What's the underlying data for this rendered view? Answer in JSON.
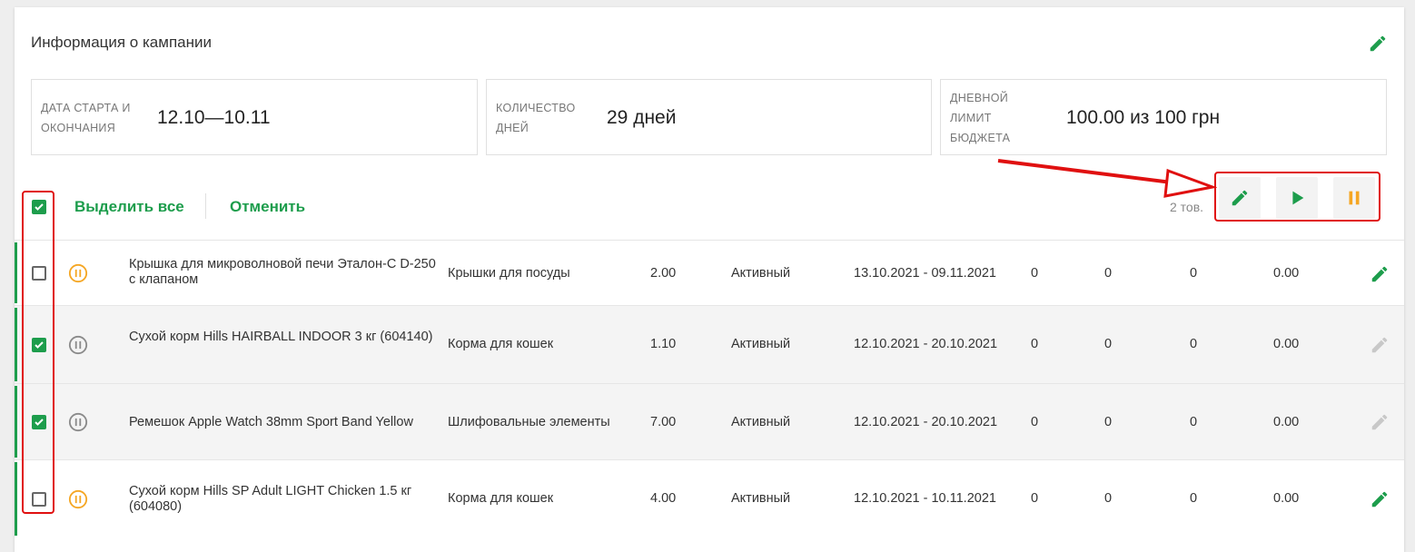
{
  "panel": {
    "title": "Информация о кампании"
  },
  "info": {
    "dates": {
      "label_1": "ДАТА СТАРТА И",
      "label_2": "ОКОНЧАНИЯ",
      "value": "12.10—10.11"
    },
    "days": {
      "label_1": "КОЛИЧЕСТВО",
      "label_2": "ДНЕЙ",
      "value": "29 дней"
    },
    "budget": {
      "label_1": "ДНЕВНОЙ",
      "label_2": "ЛИМИТ",
      "label_3": "БЮДЖЕТА",
      "value": "100.00 из 100 грн"
    }
  },
  "toolbar": {
    "select_all": "Выделить все",
    "cancel": "Отменить",
    "count": "2 тов."
  },
  "colors": {
    "accent": "#1d9d4c",
    "pause": "#f5a623",
    "inactive": "#8a8a8a",
    "highlight": "#e01010"
  },
  "rows": [
    {
      "checked": false,
      "status_icon": "pause-circle-icon",
      "name": "Крышка для микроволновой печи Эталон-С D-250 с клапаном",
      "category": "Крышки для посуды",
      "bid": "2.00",
      "status": "Активный",
      "period": "13.10.2021 - 09.11.2021",
      "c1": "0",
      "c2": "0",
      "c3": "0",
      "cost": "0.00",
      "editable": true
    },
    {
      "checked": true,
      "status_icon": "pause-circle-icon",
      "name": "Сухой корм Hills HAIRBALL INDOOR 3 кг (604140)",
      "category": "Корма для кошек",
      "bid": "1.10",
      "status": "Активный",
      "period": "12.10.2021 - 20.10.2021",
      "c1": "0",
      "c2": "0",
      "c3": "0",
      "cost": "0.00",
      "editable": false
    },
    {
      "checked": true,
      "status_icon": "pause-circle-icon",
      "name": "Ремешок Apple Watch 38mm Sport Band Yellow",
      "category": "Шлифовальные элементы",
      "bid": "7.00",
      "status": "Активный",
      "period": "12.10.2021 - 20.10.2021",
      "c1": "0",
      "c2": "0",
      "c3": "0",
      "cost": "0.00",
      "editable": false
    },
    {
      "checked": false,
      "status_icon": "pause-circle-icon",
      "name": "Сухой корм Hills SP Adult LIGHT Chicken 1.5 кг (604080)",
      "category": "Корма для кошек",
      "bid": "4.00",
      "status": "Активный",
      "period": "12.10.2021 - 10.11.2021",
      "c1": "0",
      "c2": "0",
      "c3": "0",
      "cost": "0.00",
      "editable": true
    }
  ]
}
